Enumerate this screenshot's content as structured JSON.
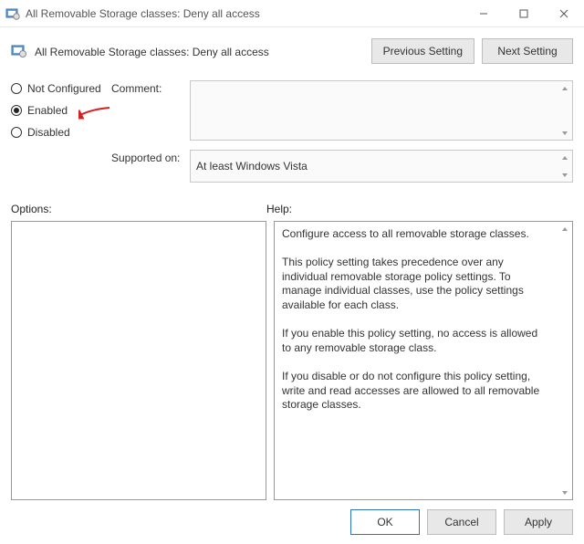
{
  "window": {
    "title": "All Removable Storage classes: Deny all access"
  },
  "header": {
    "policy_name": "All Removable Storage classes: Deny all access",
    "prev_btn": "Previous Setting",
    "next_btn": "Next Setting"
  },
  "radios": {
    "not_configured": "Not Configured",
    "enabled": "Enabled",
    "disabled": "Disabled",
    "selected": "enabled"
  },
  "fields": {
    "comment_label": "Comment:",
    "comment_value": "",
    "supported_label": "Supported on:",
    "supported_value": "At least Windows Vista"
  },
  "panels": {
    "options_label": "Options:",
    "help_label": "Help:",
    "help_text": "Configure access to all removable storage classes.\n\nThis policy setting takes precedence over any individual removable storage policy settings. To manage individual classes, use the policy settings available for each class.\n\nIf you enable this policy setting, no access is allowed to any removable storage class.\n\nIf you disable or do not configure this policy setting, write and read accesses are allowed to all removable storage classes."
  },
  "footer": {
    "ok": "OK",
    "cancel": "Cancel",
    "apply": "Apply"
  }
}
